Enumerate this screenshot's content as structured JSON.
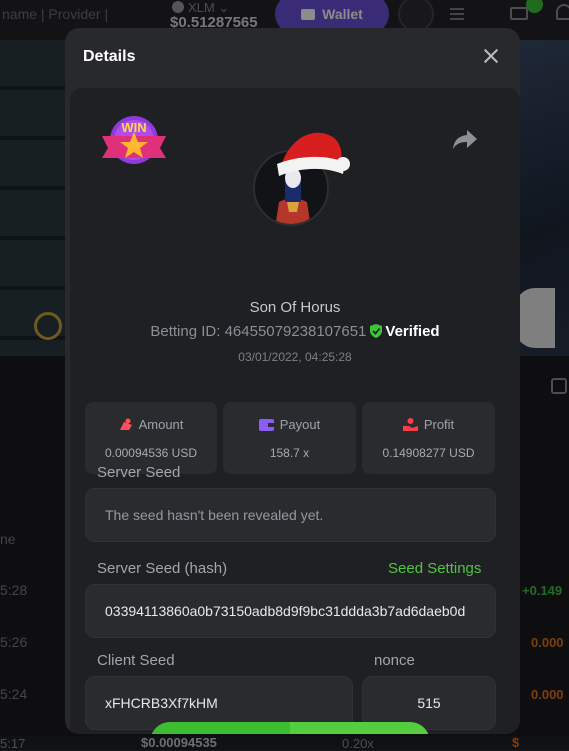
{
  "background": {
    "topbar": {
      "left_text": "name | Provider |",
      "coin": "XLM",
      "balance": "$0.51287565",
      "wallet_label": "Wallet"
    },
    "table": {
      "col_header": "ne",
      "times": [
        "5:28",
        "5:26",
        "5:24",
        "5:17"
      ],
      "profit_green": "+0.149",
      "profit_orange": [
        "0.000",
        "0.000"
      ],
      "profit_orange_partial": "$",
      "bottom_amount": "$0.00094535",
      "bottom_payout": "0.20x"
    }
  },
  "modal": {
    "title": "Details",
    "game": {
      "name": "Son Of Horus",
      "betting_id_label": "Betting ID: 464550792381076​51",
      "verified_label": "Verified",
      "timestamp": "03/01/2022, 04:25:28"
    },
    "stats": [
      {
        "label": "Amount",
        "value": "0.00094536 USD",
        "icon": "coins-icon",
        "color": "#ff4d5a"
      },
      {
        "label": "Payout",
        "value": "158.7 x",
        "icon": "wallet-icon",
        "color": "#8b5cf6"
      },
      {
        "label": "Profit",
        "value": "0.14908277 USD",
        "icon": "hand-money-icon",
        "color": "#ff3b4a"
      }
    ],
    "server_seed": {
      "label": "Server Seed",
      "value": "The seed hasn't been revealed yet."
    },
    "server_seed_hash": {
      "label": "Server Seed (hash)",
      "settings_label": "Seed Settings",
      "value": "03394113860a0b73150adb8d9f9bc31ddda3b7ad6daeb0d"
    },
    "client_seed": {
      "label": "Client Seed",
      "value": "xFHCRB3Xf7kHM"
    },
    "nonce": {
      "label": "nonce",
      "value": "515"
    },
    "badge_text": "WIN"
  },
  "colors": {
    "accent_green": "#4fc43f",
    "wallet_purple": "#6b4fd8",
    "verified_green": "#3dc43a"
  }
}
